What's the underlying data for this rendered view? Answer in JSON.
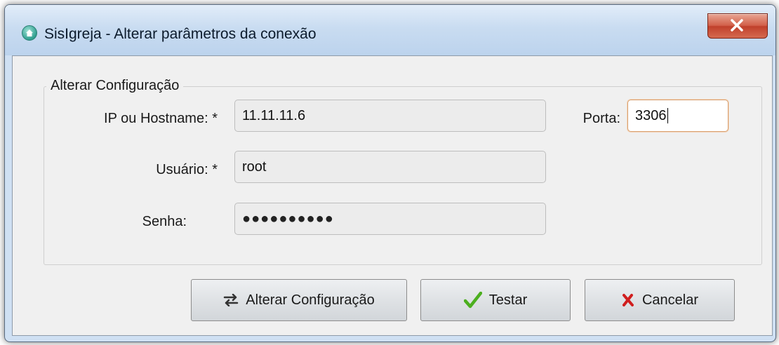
{
  "window": {
    "title": "SisIgreja - Alterar parâmetros da conexão"
  },
  "group": {
    "legend": "Alterar Configuração"
  },
  "form": {
    "host_label": "IP ou Hostname: *",
    "host_value": "11.11.11.6",
    "port_label": "Porta:",
    "port_value": "3306",
    "user_label": "Usuário: *",
    "user_value": "root",
    "password_label": "Senha:",
    "password_value": "●●●●●●●●●●"
  },
  "buttons": {
    "apply_label": "Alterar Configuração",
    "test_label": "Testar",
    "cancel_label": "Cancelar"
  },
  "icons": {
    "app": "house-icon",
    "close": "close-icon",
    "apply": "swap-arrows-icon",
    "test": "check-icon",
    "cancel": "x-mark-icon"
  },
  "colors": {
    "check": "#4caf1f",
    "x_mark": "#d01e1e",
    "close_button": "#c94a33"
  }
}
